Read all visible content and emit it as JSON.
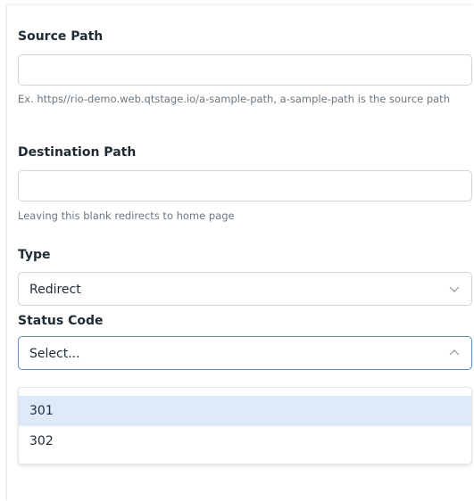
{
  "form": {
    "source_path": {
      "label": "Source Path",
      "value": "",
      "help": "Ex. https//rio-demo.web.qtstage.io/a-sample-path, a-sample-path is the source path"
    },
    "destination_path": {
      "label": "Destination Path",
      "value": "",
      "help": "Leaving this blank redirects to home page"
    },
    "type": {
      "label": "Type",
      "value": "Redirect",
      "icon": "chevron-down-icon"
    },
    "status_code": {
      "label": "Status Code",
      "placeholder": "Select...",
      "icon": "chevron-up-icon",
      "open": true,
      "options": [
        {
          "label": "301",
          "highlighted": true
        },
        {
          "label": "302",
          "highlighted": false
        }
      ]
    }
  },
  "colors": {
    "focus_border": "#5b8bc4",
    "highlight": "#dceafb",
    "label_text": "#1f2b33",
    "help_text": "#6b7780"
  }
}
